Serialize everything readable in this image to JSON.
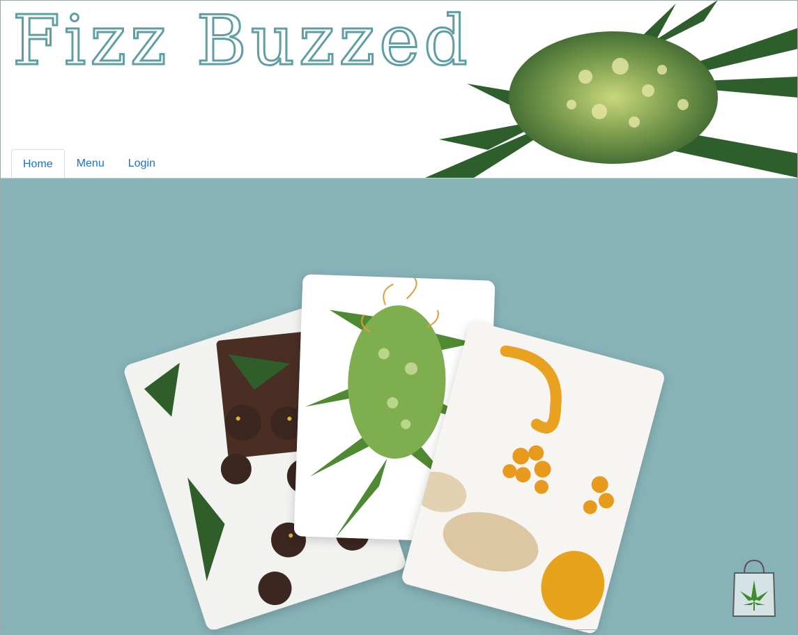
{
  "header": {
    "site_title": "Fizz Buzzed"
  },
  "nav": {
    "tabs": [
      {
        "label": "Home",
        "active": true
      },
      {
        "label": "Menu",
        "active": false
      },
      {
        "label": "Login",
        "active": false
      }
    ]
  },
  "colors": {
    "brand_teal": "#5f9ea3",
    "background": "#87b3b8",
    "link": "#1a73c9"
  },
  "icons": {
    "cart": "shopping-bag-leaf-icon"
  }
}
